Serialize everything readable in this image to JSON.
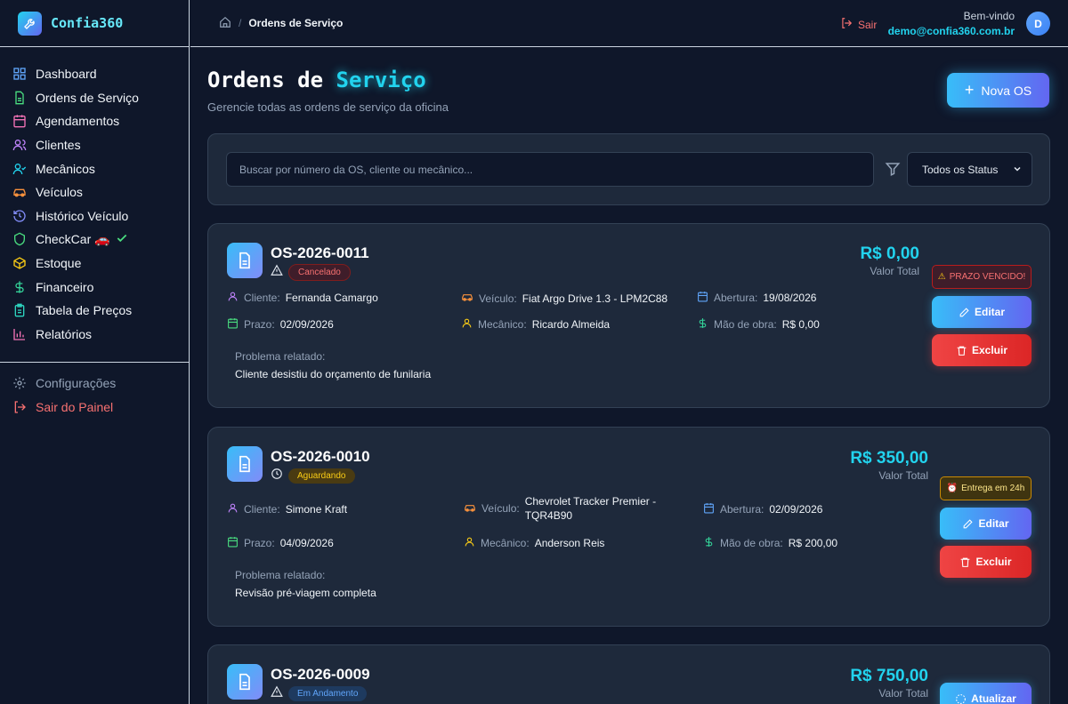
{
  "app": {
    "name": "Confia360"
  },
  "sidebar": {
    "items": [
      {
        "label": "Dashboard",
        "icon": "grid-icon"
      },
      {
        "label": "Ordens de Serviço",
        "icon": "document-icon"
      },
      {
        "label": "Agendamentos",
        "icon": "calendar-icon"
      },
      {
        "label": "Clientes",
        "icon": "users-icon"
      },
      {
        "label": "Mecânicos",
        "icon": "user-check-icon"
      },
      {
        "label": "Veículos",
        "icon": "car-icon"
      },
      {
        "label": "Histórico Veículo",
        "icon": "history-icon"
      },
      {
        "label": "CheckCar 🚗",
        "icon": "shield-icon"
      },
      {
        "label": "Estoque",
        "icon": "box-icon"
      },
      {
        "label": "Financeiro",
        "icon": "dollar-icon"
      },
      {
        "label": "Tabela de Preços",
        "icon": "clipboard-icon"
      },
      {
        "label": "Relatórios",
        "icon": "bar-chart-icon"
      }
    ],
    "bottom": [
      {
        "label": "Configurações",
        "icon": "gear-icon"
      },
      {
        "label": "Sair do Painel",
        "icon": "logout-icon"
      }
    ]
  },
  "topbar": {
    "breadcrumb": "Ordens de Serviço",
    "logout": "Sair",
    "welcome": "Bem-vindo",
    "email": "demo@confia360.com.br",
    "avatar_initial": "D"
  },
  "page": {
    "title_a": "Ordens de",
    "title_b": "Serviço",
    "subtitle": "Gerencie todas as ordens de serviço da oficina",
    "new_button": "Nova OS"
  },
  "filter": {
    "search_placeholder": "Buscar por número da OS, cliente ou mecânico...",
    "status_selected": "Todos os Status"
  },
  "labels": {
    "cliente": "Cliente:",
    "veiculo": "Veículo:",
    "abertura": "Abertura:",
    "prazo": "Prazo:",
    "mecanico": "Mecânico:",
    "mao_obra": "Mão de obra:",
    "problema": "Problema relatado:",
    "valor_total": "Valor Total",
    "editar": "Editar",
    "excluir": "Excluir",
    "atualizar": "Atualizar"
  },
  "orders": [
    {
      "number": "OS-2026-0011",
      "status": "Cancelado",
      "total": "R$ 0,00",
      "alert": "PRAZO VENCIDO!",
      "cliente": "Fernanda Camargo",
      "veiculo": "Fiat Argo Drive 1.3 - LPM2C88",
      "abertura": "19/08/2026",
      "prazo": "02/09/2026",
      "mecanico": "Ricardo Almeida",
      "mao_obra": "R$ 0,00",
      "problema": "Cliente desistiu do orçamento de funilaria"
    },
    {
      "number": "OS-2026-0010",
      "status": "Aguardando",
      "total": "R$ 350,00",
      "alert": "Entrega em 24h",
      "cliente": "Simone Kraft",
      "veiculo_line1": "Chevrolet Tracker Premier -",
      "veiculo_line2": "TQR4B90",
      "abertura": "02/09/2026",
      "prazo": "04/09/2026",
      "mecanico": "Anderson Reis",
      "mao_obra": "R$ 200,00",
      "problema": "Revisão pré-viagem completa"
    },
    {
      "number": "OS-2026-0009",
      "status": "Em Andamento",
      "total": "R$ 750,00"
    }
  ]
}
